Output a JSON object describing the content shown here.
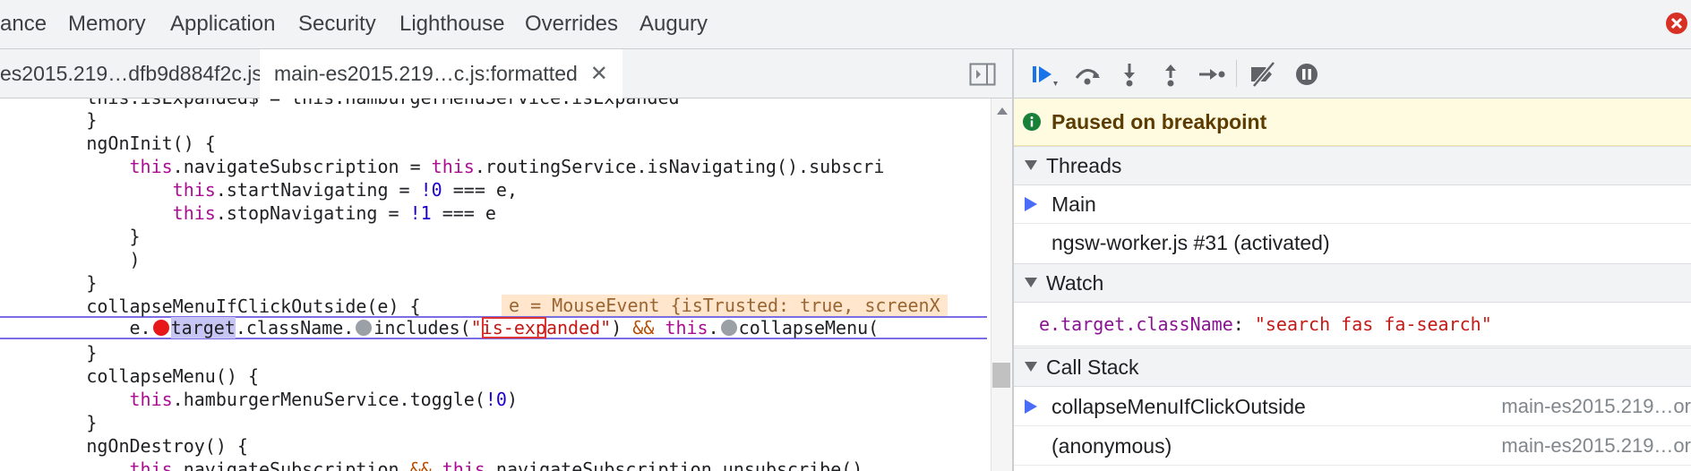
{
  "panel_tabs": [
    "ance",
    "Memory",
    "Application",
    "Security",
    "Lighthouse",
    "Overrides",
    "Augury"
  ],
  "file_tabs": {
    "tab1": "es2015.219…dfb9d884f2c.js",
    "tab2": "main-es2015.219…c.js:formatted",
    "close_glyph": "✕"
  },
  "code": {
    "l0": "        this.isExpanded$ = this.hamburgerMenuService.isExpanded",
    "l1": "        }",
    "l2": "        ngOnInit() {",
    "l3a": "            ",
    "l3_kw": "this",
    "l3b": ".navigateSubscription = ",
    "l3_kw2": "this",
    "l3c": ".routingService.isNavigating().subscri",
    "l4a": "                ",
    "l4_kw": "this",
    "l4b": ".startNavigating = ",
    "l4_op": "!0",
    "l4c": " === e,",
    "l5a": "                ",
    "l5_kw": "this",
    "l5b": ".stopNavigating = ",
    "l5_op": "!1",
    "l5c": " === e",
    "l6": "            }",
    "l7": "            )",
    "l8": "        }",
    "l9": "        collapseMenuIfClickOutside(e) {",
    "l9_inline": "e = MouseEvent {isTrusted: true, screenX",
    "l10a": "            e.",
    "l10_sel": "target",
    "l10b": ".className.",
    "l10c": "includes(",
    "l10_q1": "\"",
    "l10_box": "is-exp",
    "l10_str": "anded\"",
    "l10d": ") ",
    "l10_op": "&&",
    "l10e": " ",
    "l10_kw": "this",
    "l10f": ".",
    "l10g": "collapseMenu(",
    "l11": "        }",
    "l12": "        collapseMenu() {",
    "l13a": "            ",
    "l13_kw": "this",
    "l13b": ".hamburgerMenuService.toggle(",
    "l13_nu": "!0",
    "l13c": ")",
    "l14": "        }",
    "l15": "        ngOnDestroy() {",
    "l16a": "            ",
    "l16_kw": "this",
    "l16b": ".navigateSubscription ",
    "l16_op": "&&",
    "l16c": " ",
    "l16_kw2": "this",
    "l16d": ".navigateSubscription.unsubscribe()"
  },
  "debugger": {
    "paused_text": "Paused on breakpoint",
    "threads_title": "Threads",
    "threads": [
      "Main",
      "ngsw-worker.js #31 (activated)"
    ],
    "watch_title": "Watch",
    "watch_expr": "e.target.className",
    "watch_sep": ": ",
    "watch_value": "\"search fas fa-search\"",
    "callstack_title": "Call Stack",
    "callstack": [
      {
        "fn": "collapseMenuIfClickOutside",
        "file": "main-es2015.219…or"
      },
      {
        "fn": "(anonymous)",
        "file": "main-es2015.219…or"
      }
    ]
  },
  "colors": {
    "accent": "#4a6cf7",
    "breakpoint": "#e81818",
    "paused_bg": "#fffbe0"
  }
}
